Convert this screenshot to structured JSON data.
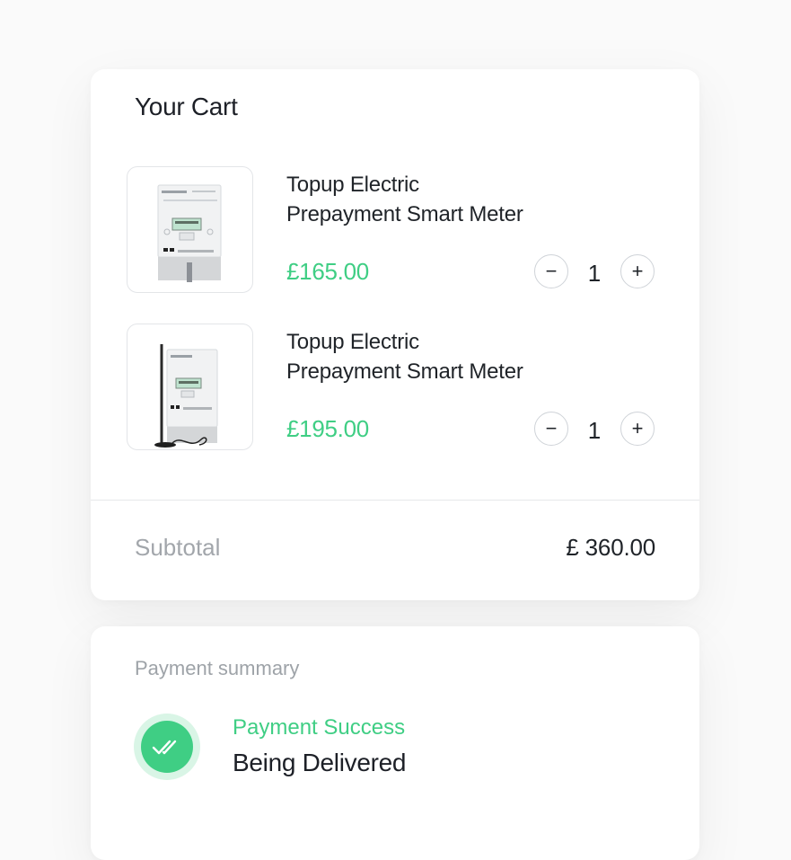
{
  "cart": {
    "title": "Your Cart",
    "items": [
      {
        "name_line1": "Topup Electric",
        "name_line2": "Prepayment Smart Meter",
        "price": "£165.00",
        "quantity": "1",
        "image": "smart-meter-image"
      },
      {
        "name_line1": "Topup Electric",
        "name_line2": "Prepayment Smart Meter",
        "price": "£195.00",
        "quantity": "1",
        "image": "smart-meter-with-antenna-image"
      }
    ],
    "minus_symbol": "−",
    "plus_symbol": "+",
    "subtotal_label": "Subtotal",
    "subtotal_value": "£ 360.00"
  },
  "payment": {
    "title": "Payment summary",
    "status": "Payment Success",
    "detail": "Being Delivered",
    "status_icon": "double-check-icon"
  },
  "colors": {
    "accent": "#3fce84",
    "accent_light": "#d9f5e6",
    "text": "#1f2328",
    "muted": "#a2a6ab"
  }
}
